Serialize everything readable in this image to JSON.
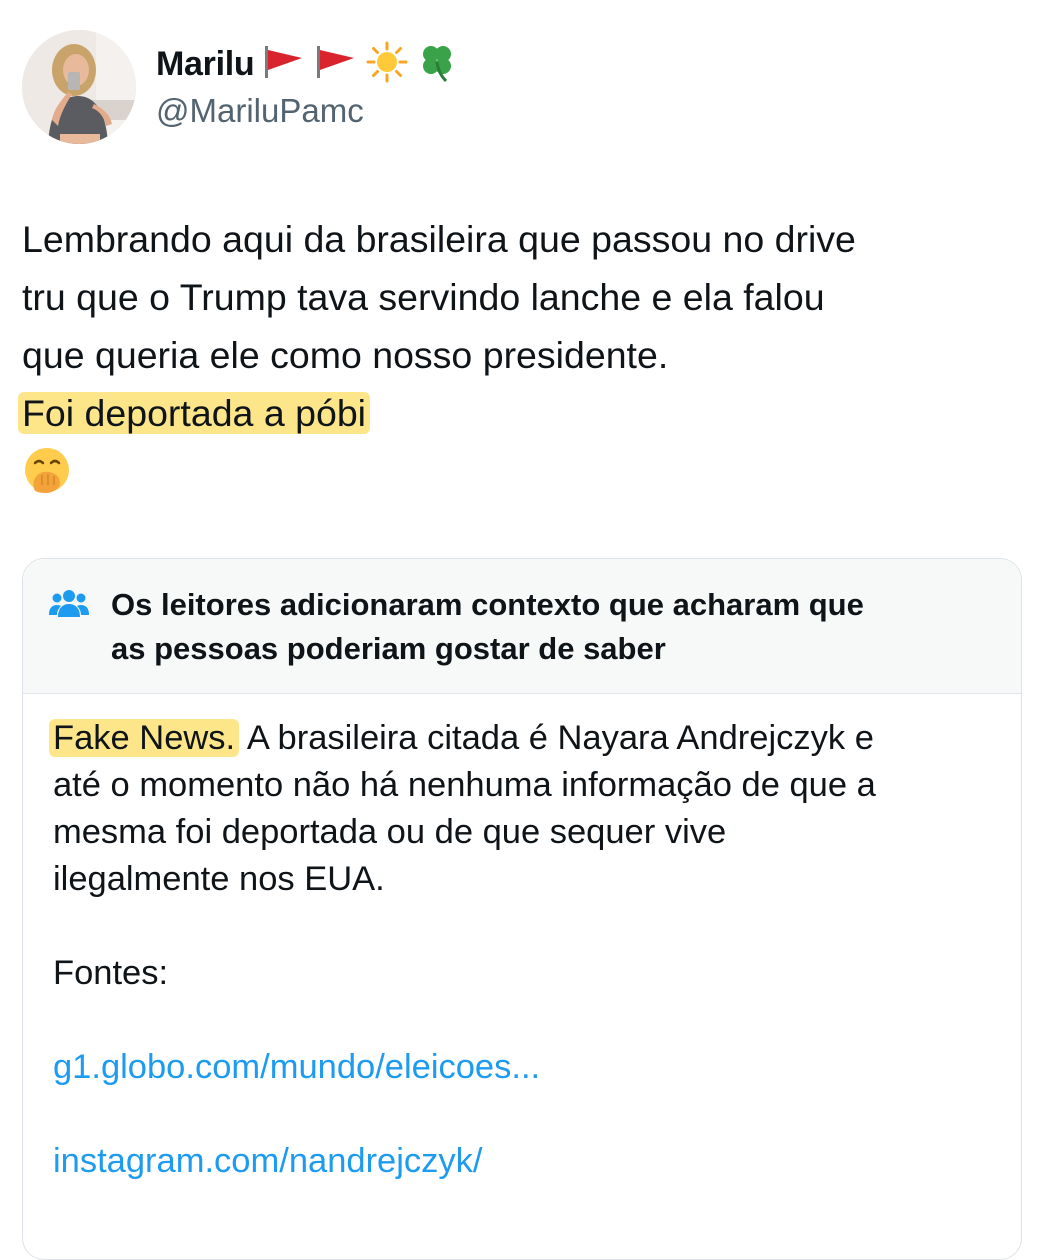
{
  "author": {
    "display_name": "Marilu",
    "name_emojis": [
      "triangular-flag-icon",
      "triangular-flag-icon",
      "sun-icon",
      "four-leaf-clover-icon"
    ],
    "handle": "@MariluPamc"
  },
  "tweet": {
    "lines": [
      "Lembrando aqui da brasileira que passou no drive",
      "tru que o Trump tava servindo lanche e ela falou",
      "que queria ele como nosso presidente."
    ],
    "highlighted_line": "Foi deportada a póbi",
    "trailing_emoji": "face-with-hand-over-mouth-icon",
    "highlight_color": "#fde68a"
  },
  "community_note": {
    "title_line1": "Os leitores adicionaram contexto que acharam que",
    "title_line2": "as pessoas poderiam gostar de saber",
    "label": "Fake News.",
    "text_line1_rest": " A brasileira citada é Nayara Andrejczyk e",
    "text_line2": "até o momento não há nenhuma informação de que a",
    "text_line3": "mesma foi deportada ou de que sequer vive",
    "text_line4": "ilegalmente nos EUA.",
    "sources_label": "Fontes:",
    "links": [
      "g1.globo.com/mundo/eleicoes...",
      "instagram.com/nandrejczyk/"
    ],
    "header_bg": "#f7f9f9",
    "link_color": "#1d9bf0"
  },
  "colors": {
    "text": "#0f1419",
    "secondary_text": "#536471",
    "accent": "#1d9bf0"
  }
}
